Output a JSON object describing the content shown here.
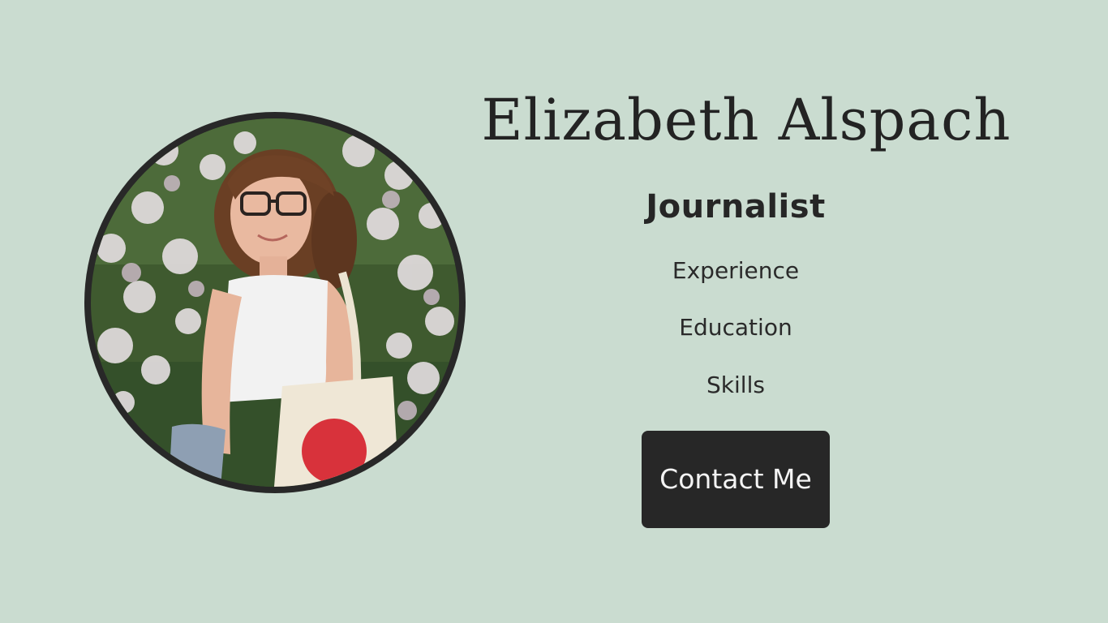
{
  "profile": {
    "name": "Elizabeth Alspach",
    "role": "Journalist"
  },
  "nav": {
    "experience": "Experience",
    "education": "Education",
    "skills": "Skills"
  },
  "contact": {
    "label": "Contact Me"
  },
  "colors": {
    "background": "#cadcd0",
    "button": "#272727",
    "text": "#232323",
    "ring": "#282828"
  }
}
